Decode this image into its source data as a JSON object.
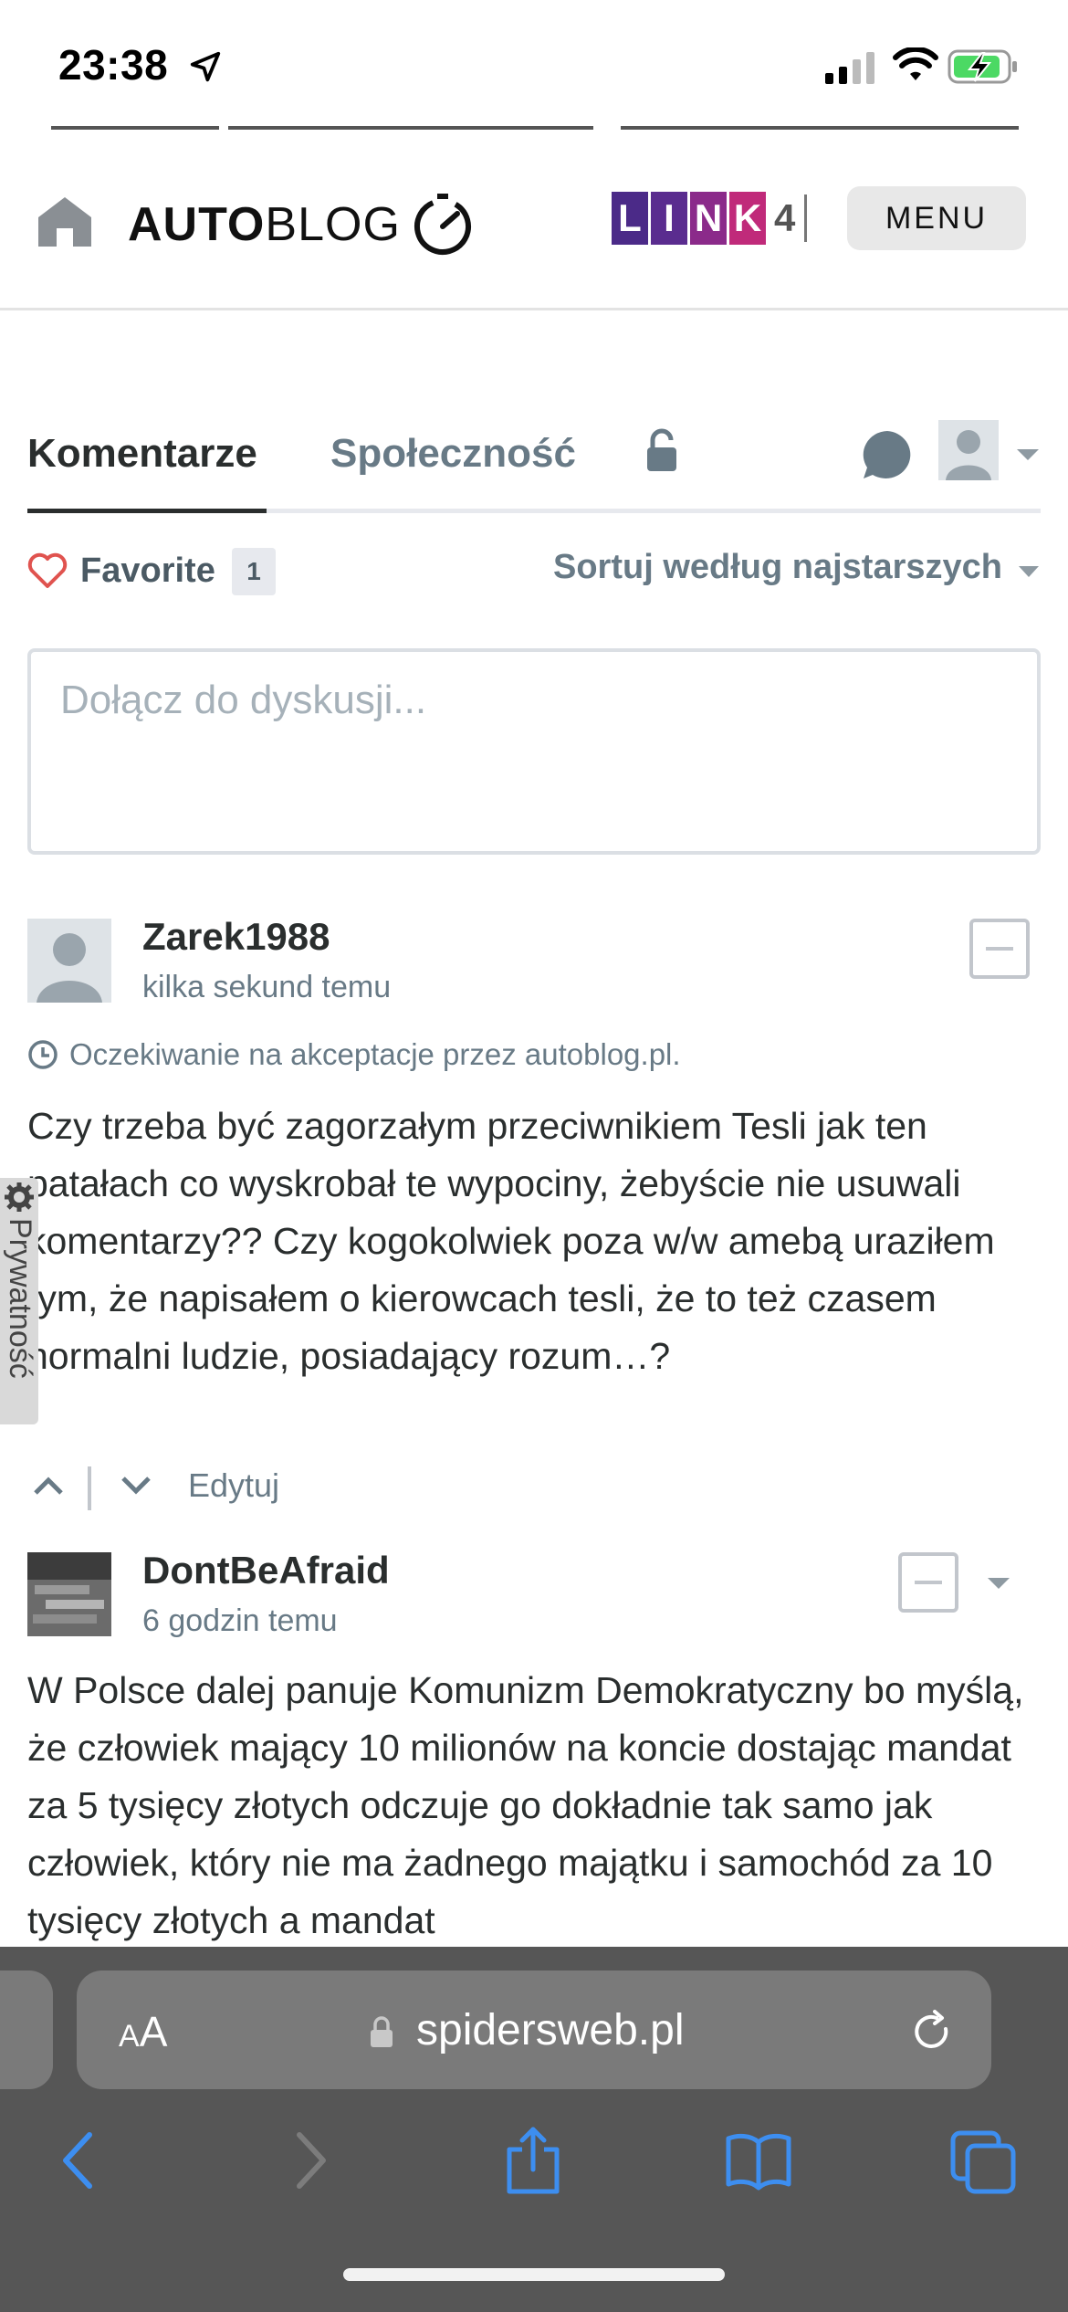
{
  "status_bar": {
    "time": "23:38"
  },
  "header": {
    "logo_auto": "AUTO",
    "logo_blog": "BLOG",
    "sponsor_letters": [
      "L",
      "I",
      "N",
      "K"
    ],
    "sponsor_number": "4",
    "sponsor_colors": [
      "#4b2a88",
      "#5a2c8f",
      "#8b2a8a",
      "#c02a7a"
    ],
    "menu_label": "MENU"
  },
  "tabs": {
    "comments_label": "Komentarze",
    "community_label": "Społeczność"
  },
  "favorite": {
    "label": "Favorite",
    "count": "1",
    "sort_label": "Sortuj według najstarszych"
  },
  "comment_input": {
    "placeholder": "Dołącz do dyskusji..."
  },
  "comments": [
    {
      "author": "Zarek1988",
      "time": "kilka sekund temu",
      "pending": "Oczekiwanie na akceptacje przez autoblog.pl.",
      "text": "Czy trzeba być zagorzałym przeciwnikiem Tesli jak ten patałach co wyskrobał te wypociny, żebyście nie usuwali komentarzy?? Czy kogokolwiek poza w/w amebą uraziłem tym, że napisałem o kierowcach tesli, że to też czasem normalni ludzie, posiadający rozum…?",
      "edit_label": "Edytuj"
    },
    {
      "author": "DontBeAfraid",
      "time": "6 godzin temu",
      "text": "W Polsce dalej panuje Komunizm Demokratyczny bo myślą, że człowiek mający 10 milionów na koncie dostając mandat za 5 tysięcy złotych odczuje go dokładnie tak samo jak człowiek, który nie ma żadnego majątku i samochód za 10 tysięcy złotych a mandat"
    }
  ],
  "privacy_tab": {
    "label": "Prywatność"
  },
  "browser": {
    "aa_small": "A",
    "aa_large": "A",
    "url": "spidersweb.pl"
  },
  "colors": {
    "accent_blue": "#3d8ef0",
    "text_dark": "#2a2e2e",
    "text_muted": "#687a86",
    "safari_bg": "#565656"
  }
}
